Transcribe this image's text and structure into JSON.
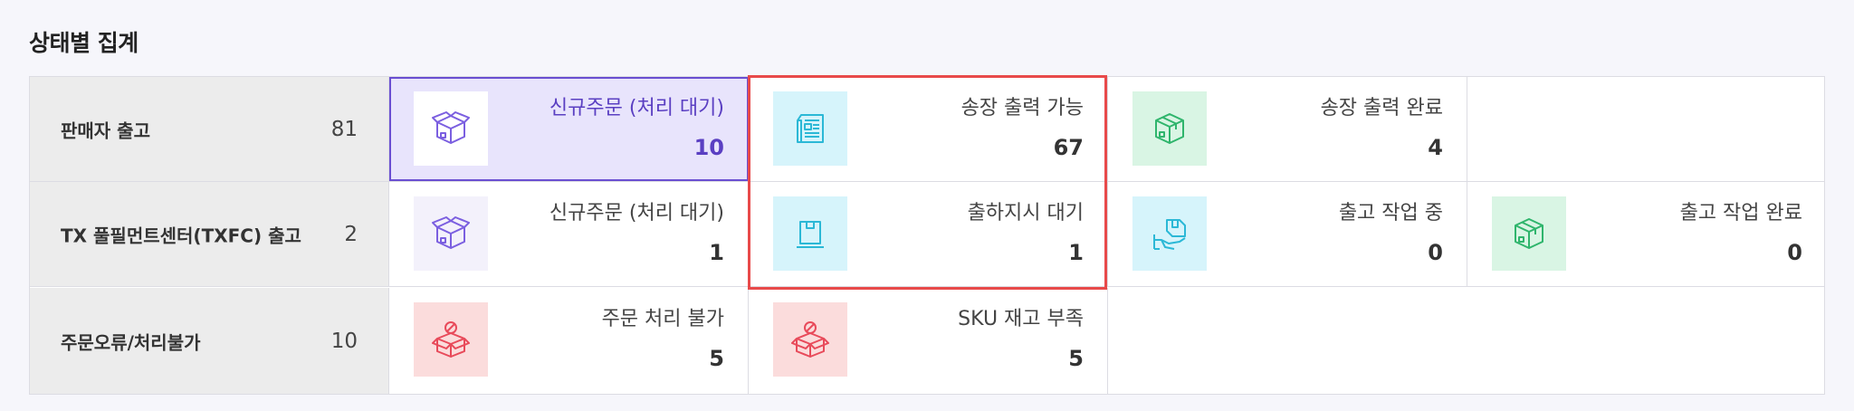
{
  "section_title": "상태별 집계",
  "rows": [
    {
      "label": "판매자 출고",
      "count": "81",
      "cells": [
        {
          "label": "신규주문 (처리 대기)",
          "value": "10",
          "icon": "box-open-icon",
          "color": "#7b5fe0",
          "selected": true
        },
        {
          "label": "송장 출력 가능",
          "value": "67",
          "icon": "document-icon",
          "color": "#2bb8d6"
        },
        {
          "label": "송장 출력 완료",
          "value": "4",
          "icon": "box-done-icon",
          "color": "#2fb56c"
        }
      ]
    },
    {
      "label": "TX 풀필먼트센터(TXFC) 출고",
      "count": "2",
      "cells": [
        {
          "label": "신규주문 (처리 대기)",
          "value": "1",
          "icon": "box-open-icon",
          "color": "#7b5fe0"
        },
        {
          "label": "출하지시 대기",
          "value": "1",
          "icon": "box-flat-icon",
          "color": "#2bb8d6"
        },
        {
          "label": "출고 작업 중",
          "value": "0",
          "icon": "hand-box-icon",
          "color": "#2bb8d6"
        },
        {
          "label": "출고 작업 완료",
          "value": "0",
          "icon": "box-done-icon",
          "color": "#2fb56c"
        }
      ]
    },
    {
      "label": "주문오류/처리불가",
      "count": "10",
      "cells": [
        {
          "label": "주문 처리 불가",
          "value": "5",
          "icon": "box-blocked-icon",
          "color": "#e84a5a"
        },
        {
          "label": "SKU 재고 부족",
          "value": "5",
          "icon": "box-blocked-icon",
          "color": "#e84a5a"
        }
      ]
    }
  ]
}
